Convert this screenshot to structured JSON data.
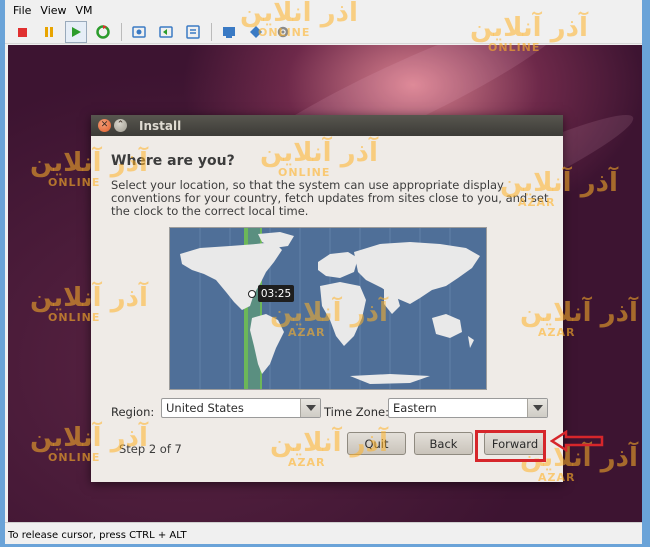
{
  "menu": [
    "File",
    "View",
    "VM"
  ],
  "toolbar": {
    "buttons": [
      {
        "icon": "stop-icon",
        "color": "#e03030"
      },
      {
        "icon": "pause-icon",
        "color": "#e8a400"
      },
      {
        "icon": "play-icon",
        "color": "#2c9c2c",
        "active": true
      },
      {
        "icon": "reset-icon",
        "color": "#2c9c2c"
      },
      {
        "icon": "snapshot-take-icon",
        "color": "#3a7ac4"
      },
      {
        "icon": "snapshot-revert-icon",
        "color": "#3a7ac4"
      },
      {
        "icon": "snapshot-manager-icon",
        "color": "#3a7ac4"
      },
      {
        "icon": "fullscreen-icon",
        "color": "#3a7ac4"
      },
      {
        "icon": "unity-icon",
        "color": "#3a7ac4"
      },
      {
        "icon": "settings-icon",
        "color": "#8a8a8a"
      }
    ]
  },
  "dialog": {
    "title": "Install",
    "heading": "Where are you?",
    "description": "Select your location, so that the system can use appropriate display conventions for your country, fetch updates from sites close to you, and set the clock to the correct local time.",
    "map": {
      "time_label": "03:25"
    },
    "region": {
      "label": "Region:",
      "value": "United States"
    },
    "timezone": {
      "label": "Time Zone:",
      "value": "Eastern"
    },
    "step": "Step 2 of 7",
    "buttons": {
      "quit": "Quit",
      "back": "Back",
      "forward": "Forward"
    }
  },
  "status_bar": "To release cursor, press CTRL + ALT",
  "watermark": {
    "script": "آذر آنلاین",
    "latin_top": "ONLINE",
    "latin": "AZAR",
    "latin_bottom": "ONLINE"
  },
  "colors": {
    "highlight": "#d6262b",
    "ocean": "#4f6f98",
    "land": "#e9e9e9",
    "timezone_band": "#6fbf52"
  }
}
